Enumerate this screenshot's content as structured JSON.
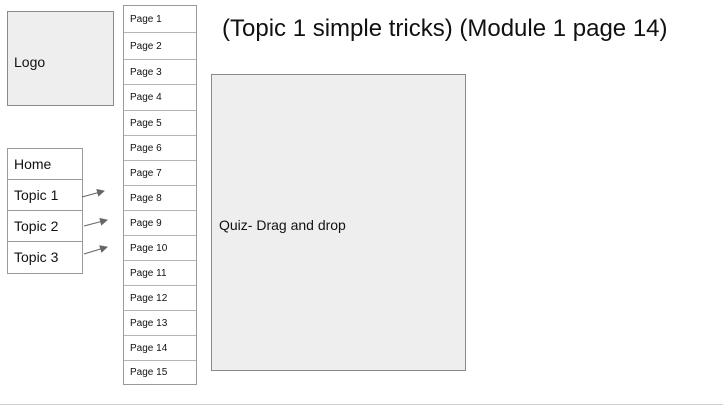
{
  "logo": {
    "label": "Logo"
  },
  "nav": {
    "items": [
      {
        "label": "Home"
      },
      {
        "label": "Topic 1"
      },
      {
        "label": "Topic 2"
      },
      {
        "label": "Topic 3"
      }
    ]
  },
  "pages": {
    "items": [
      {
        "label": "Page 1"
      },
      {
        "label": "Page 2"
      },
      {
        "label": "Page 3"
      },
      {
        "label": "Page 4"
      },
      {
        "label": "Page 5"
      },
      {
        "label": "Page 6"
      },
      {
        "label": "Page 7"
      },
      {
        "label": "Page 8"
      },
      {
        "label": "Page 9"
      },
      {
        "label": "Page 10"
      },
      {
        "label": "Page 11"
      },
      {
        "label": "Page 12"
      },
      {
        "label": "Page 13"
      },
      {
        "label": "Page 14"
      },
      {
        "label": "Page 15"
      }
    ]
  },
  "header": {
    "title": "(Topic 1 simple tricks) (Module 1 page 14)"
  },
  "content": {
    "quiz_label": "Quiz- Drag and drop"
  },
  "colors": {
    "placeholder_fill": "#eeeeee",
    "border": "#8a8a8a",
    "arrow": "#666666"
  }
}
